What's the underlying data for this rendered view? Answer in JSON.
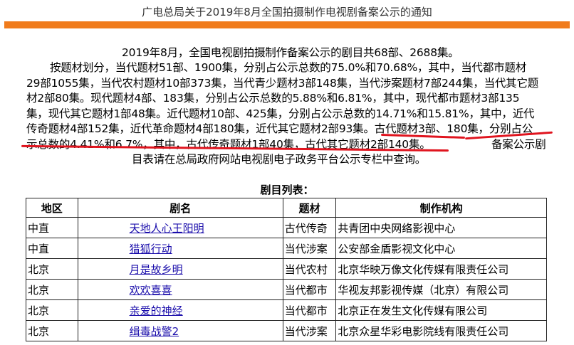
{
  "title": "广电总局关于2019年8月全国拍摄制作电视剧备案公示的通知",
  "paragraph": [
    "2019年8月，全国电视剧拍摄制作备案公示的剧目共68部、2688集。",
    "按题材划分，当代题材51部、1900集，分别占公示总数的75.0%和70.68%，其中，当代都市题材",
    "29部1055集，当代农村题材10部373集，当代青少题材3部148集，当代涉案题材7部244集，当代其它题",
    "材2部80集。现代题材4部、183集，分别占公示总数的5.88%和6.81%，其中，现代都市题材3部135",
    "集，现代其它题材1部48集。近代题材10部、425集，分别占公示总数的14.71%和15.81%，其中，近代",
    "传奇题材4部152集，近代革命题材4部180集，近代其它题材2部93集。古代题材3部、180集，分别占公",
    "示总数的4.41%和6.7%，其中，古代传奇题材1部40集，古代其它题材2部140集。",
    "备案公示剧",
    "目表请在总局政府网站电视剧电子政务平台公示专栏中查询。"
  ],
  "list_title": "剧目列表：",
  "table": {
    "headers": [
      "地区",
      "剧名",
      "题材",
      "制作机构"
    ],
    "rows": [
      [
        "中直",
        "天地人心王阳明",
        "古代传奇",
        "共青团中央网络影视中心"
      ],
      [
        "中直",
        "猎狐行动",
        "当代涉案",
        "公安部金盾影视文化中心"
      ],
      [
        "北京",
        "月是故乡明",
        "当代农村",
        "北京华映万像文化传媒有限责任公司"
      ],
      [
        "北京",
        "欢欢喜喜",
        "当代都市",
        "华视友邦影视传媒（北京）有限公司"
      ],
      [
        "北京",
        "亲爱的神经",
        "当代都市",
        "北京正在发生文化传媒有限公司"
      ],
      [
        "北京",
        "缉毒战警2",
        "当代涉案",
        "北京众星华彩电影院线有限责任公司"
      ]
    ]
  },
  "colors": {
    "accent_bar": "#f07b1c",
    "underline": "#e0141e",
    "link": "#1a0dab"
  }
}
